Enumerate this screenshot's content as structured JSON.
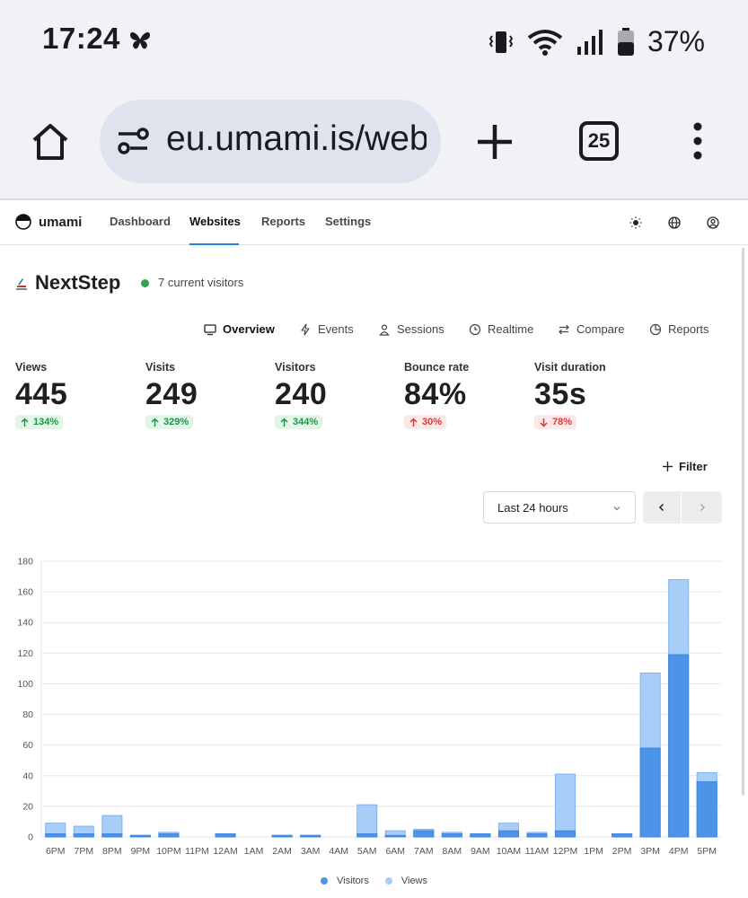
{
  "status_bar": {
    "time": "17:24",
    "battery": "37%",
    "icons": [
      "butterfly-icon",
      "vibrate-icon",
      "wifi-icon",
      "signal-icon",
      "battery-icon"
    ]
  },
  "browser": {
    "url": "eu.umami.is/webs",
    "tab_count": "25"
  },
  "app": {
    "brand": "umami",
    "nav": [
      {
        "label": "Dashboard"
      },
      {
        "label": "Websites"
      },
      {
        "label": "Reports"
      },
      {
        "label": "Settings"
      }
    ],
    "active_nav": "Websites"
  },
  "website": {
    "name": "NextStep",
    "current_visitors": "7 current visitors"
  },
  "subtabs": [
    {
      "label": "Overview",
      "icon": "monitor-icon"
    },
    {
      "label": "Events",
      "icon": "lightning-icon"
    },
    {
      "label": "Sessions",
      "icon": "user-icon"
    },
    {
      "label": "Realtime",
      "icon": "clock-icon"
    },
    {
      "label": "Compare",
      "icon": "swap-icon"
    },
    {
      "label": "Reports",
      "icon": "pie-icon"
    }
  ],
  "metrics": [
    {
      "label": "Views",
      "value": "445",
      "change": "134%",
      "direction": "up"
    },
    {
      "label": "Visits",
      "value": "249",
      "change": "329%",
      "direction": "up"
    },
    {
      "label": "Visitors",
      "value": "240",
      "change": "344%",
      "direction": "up"
    },
    {
      "label": "Bounce rate",
      "value": "84%",
      "change": "30%",
      "direction": "up-bad"
    },
    {
      "label": "Visit duration",
      "value": "35s",
      "change": "78%",
      "direction": "down"
    }
  ],
  "controls": {
    "filter_label": "Filter",
    "date_range": "Last 24 hours"
  },
  "colors": {
    "visitors": "#4b94e8",
    "views": "#a8cdf7",
    "accent": "#2680eb",
    "live": "#2ea44f"
  },
  "chart_data": {
    "type": "bar",
    "stacked": true,
    "categories": [
      "6PM",
      "7PM",
      "8PM",
      "9PM",
      "10PM",
      "11PM",
      "12AM",
      "1AM",
      "2AM",
      "3AM",
      "4AM",
      "5AM",
      "6AM",
      "7AM",
      "8AM",
      "9AM",
      "10AM",
      "11AM",
      "12PM",
      "1PM",
      "2PM",
      "3PM",
      "4PM",
      "5PM"
    ],
    "series": [
      {
        "name": "Visitors",
        "values": [
          2,
          2,
          2,
          1,
          2,
          0,
          2,
          0,
          1,
          1,
          0,
          2,
          1,
          4,
          2,
          2,
          4,
          2,
          4,
          0,
          2,
          58,
          119,
          36
        ]
      },
      {
        "name": "Views",
        "values": [
          9,
          7,
          14,
          1,
          3,
          0,
          2,
          0,
          1,
          1,
          0,
          21,
          4,
          5,
          3,
          2,
          9,
          3,
          41,
          0,
          2,
          107,
          168,
          42
        ]
      }
    ],
    "ylim": [
      0,
      180
    ],
    "yticks": [
      0,
      20,
      40,
      60,
      80,
      100,
      120,
      140,
      160,
      180
    ],
    "grid": true,
    "legend_position": "bottom"
  }
}
